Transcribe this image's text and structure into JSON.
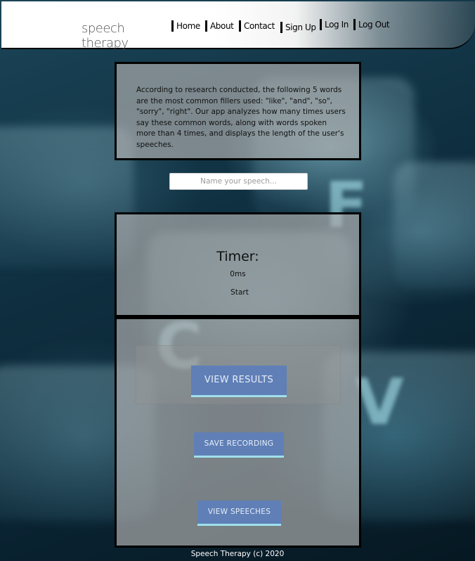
{
  "app": {
    "logo_text": "speech therapy"
  },
  "nav": {
    "items": [
      {
        "label": "Home"
      },
      {
        "label": "About"
      },
      {
        "label": "Contact"
      },
      {
        "label": "Sign Up"
      },
      {
        "label": "Log In"
      },
      {
        "label": "Log Out"
      }
    ]
  },
  "intro": {
    "text": "According to research conducted, the following 5 words are the most common fillers used: \"like\", \"and\", \"so\", \"sorry\", \"right\". Our app analyzes how many times users say these common words, along with words spoken more than 4 times, and displays the length of the user's speeches."
  },
  "speech_name": {
    "value": "",
    "placeholder": "Name your speech..."
  },
  "timer": {
    "title": "Timer:",
    "value": "0ms",
    "start_label": "Start"
  },
  "actions": {
    "view_results_label": "VIEW RESULTS",
    "save_recording_label": "SAVE RECORDING",
    "view_speeches_label": "VIEW SPEECHES"
  },
  "footer": {
    "text": "Speech Therapy (c) 2020"
  },
  "colors": {
    "button_bg": "#5f7fb6",
    "button_accent": "#9fe0ec",
    "panel_border": "#000000"
  }
}
